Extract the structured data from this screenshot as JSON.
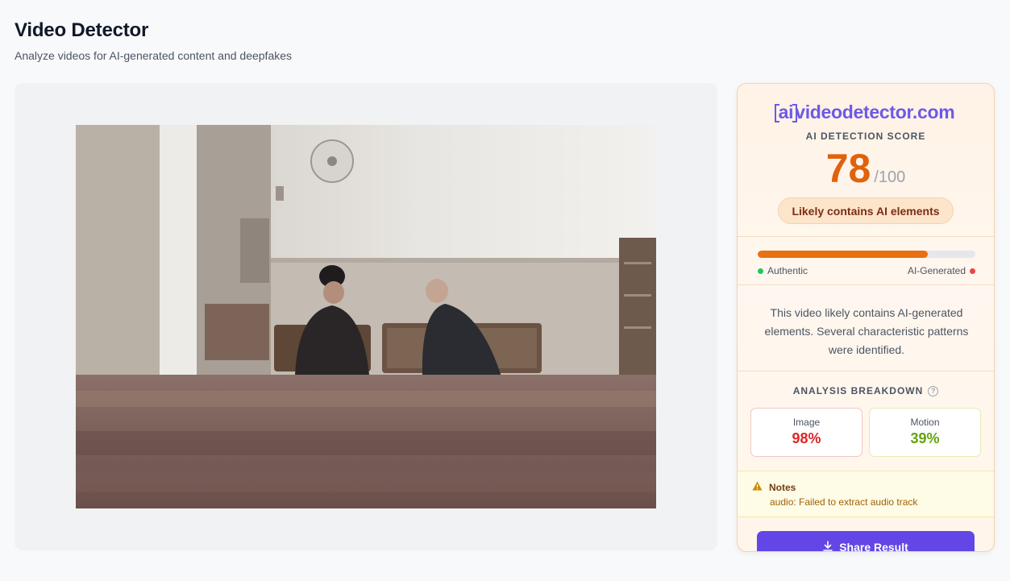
{
  "header": {
    "title": "Video Detector",
    "subtitle": "Analyze videos for AI-generated content and deepfakes"
  },
  "result": {
    "brand_ai": "ai",
    "brand_rest": "videodetector.com",
    "score_label": "AI DETECTION SCORE",
    "score": "78",
    "score_max": "/100",
    "verdict": "Likely contains AI elements",
    "progress_fraction": 0.78,
    "legend_left": "Authentic",
    "legend_right": "AI-Generated",
    "description": "This video likely contains AI-generated elements. Several characteristic patterns were identified.",
    "breakdown_title": "ANALYSIS BREAKDOWN",
    "metrics": [
      {
        "label": "Image",
        "value": "98%"
      },
      {
        "label": "Motion",
        "value": "39%"
      }
    ],
    "notes_title": "Notes",
    "notes_text": "audio: Failed to extract audio track",
    "share_label": "Share Result"
  },
  "colors": {
    "accent": "#6346e6",
    "score": "#e0620e",
    "progress": "#ea6f10",
    "image_metric": "#dc2626",
    "motion_metric": "#65a30d"
  },
  "icons": {
    "help": "help-circle-icon",
    "warning": "warning-triangle-icon",
    "download": "download-icon"
  }
}
